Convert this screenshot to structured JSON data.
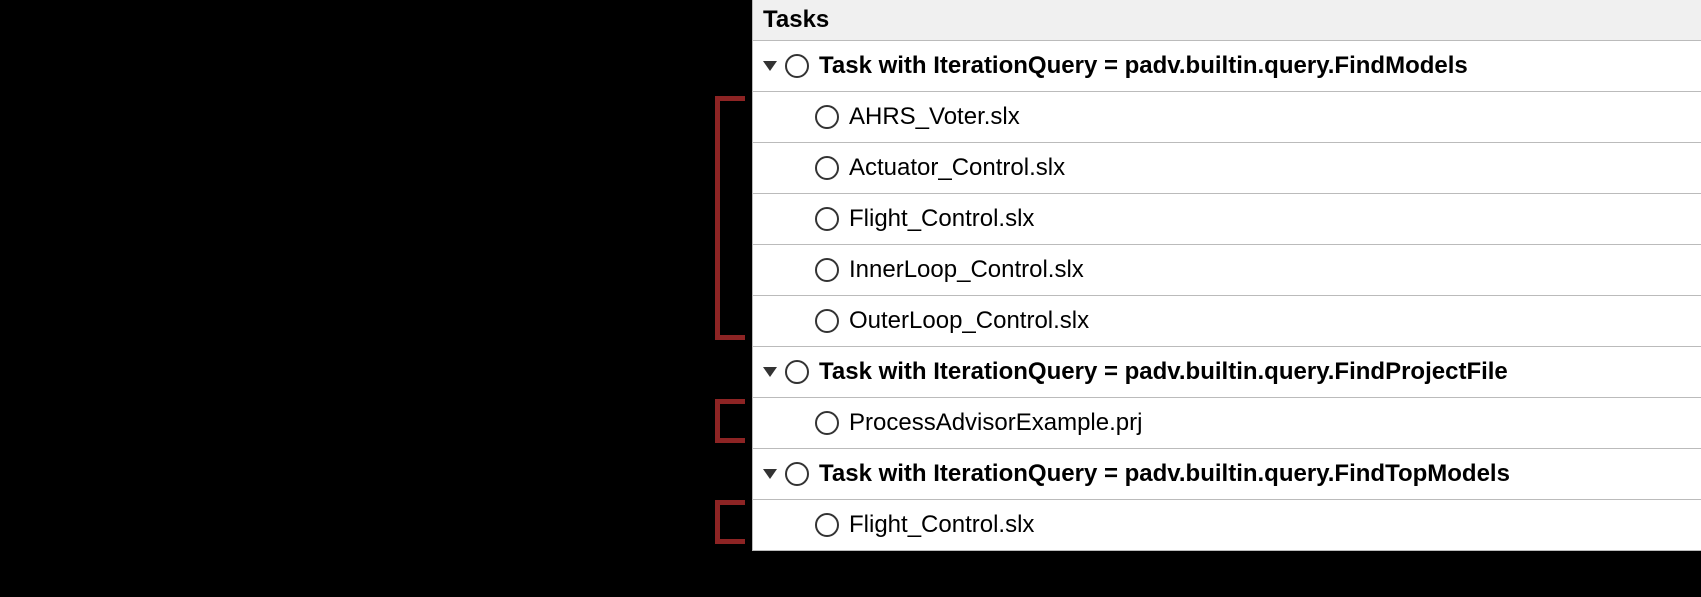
{
  "panel": {
    "title": "Tasks"
  },
  "tasks": [
    {
      "label": "Task with IterationQuery = padv.builtin.query.FindModels",
      "children": [
        "AHRS_Voter.slx",
        "Actuator_Control.slx",
        "Flight_Control.slx",
        "InnerLoop_Control.slx",
        "OuterLoop_Control.slx"
      ]
    },
    {
      "label": "Task with IterationQuery = padv.builtin.query.FindProjectFile",
      "children": [
        "ProcessAdvisorExample.prj"
      ]
    },
    {
      "label": "Task with IterationQuery = padv.builtin.query.FindTopModels",
      "children": [
        "Flight_Control.slx"
      ]
    }
  ]
}
